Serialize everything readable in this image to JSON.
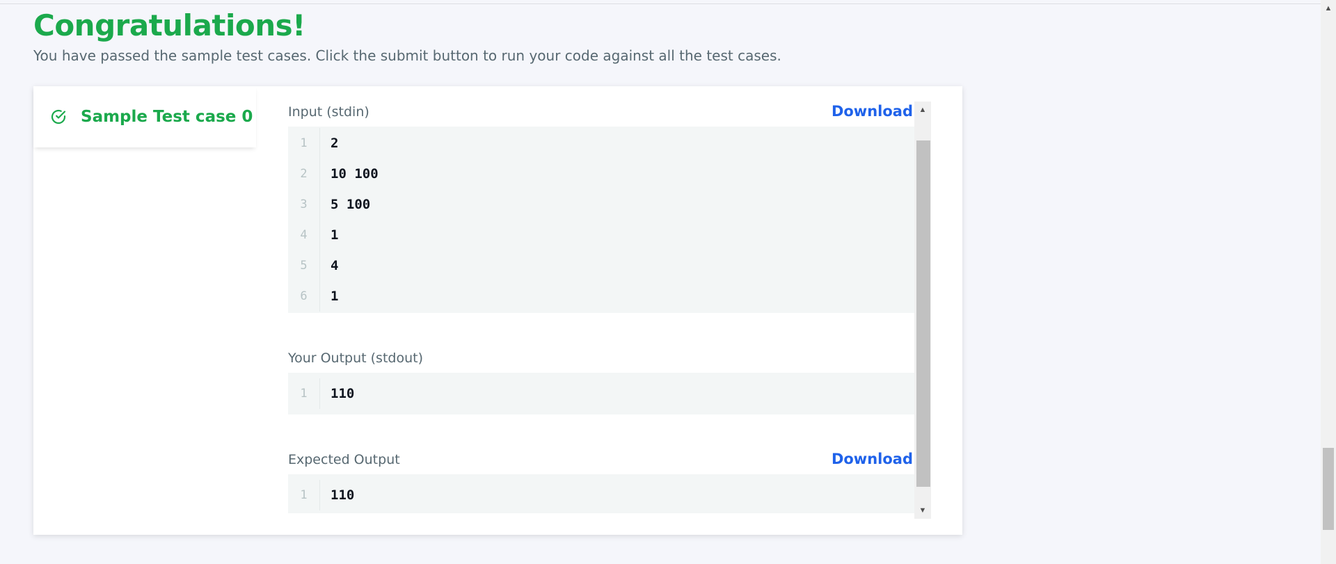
{
  "header": {
    "title": "Congratulations!",
    "subtitle": "You have passed the sample test cases. Click the submit button to run your code against all the test cases."
  },
  "test_case": {
    "tab_label": "Sample Test case 0",
    "status_icon": "check-circle-icon"
  },
  "input": {
    "label": "Input (stdin)",
    "download_label": "Download",
    "lines": [
      "2",
      "10 100",
      "5 100",
      "1",
      "4",
      "1"
    ]
  },
  "your_output": {
    "label": "Your Output (stdout)",
    "lines": [
      "110"
    ]
  },
  "expected_output": {
    "label": "Expected Output",
    "download_label": "Download",
    "lines": [
      "110"
    ]
  },
  "colors": {
    "success": "#1ba94c",
    "link": "#1f62ea",
    "code_bg": "#f3f6f6"
  }
}
